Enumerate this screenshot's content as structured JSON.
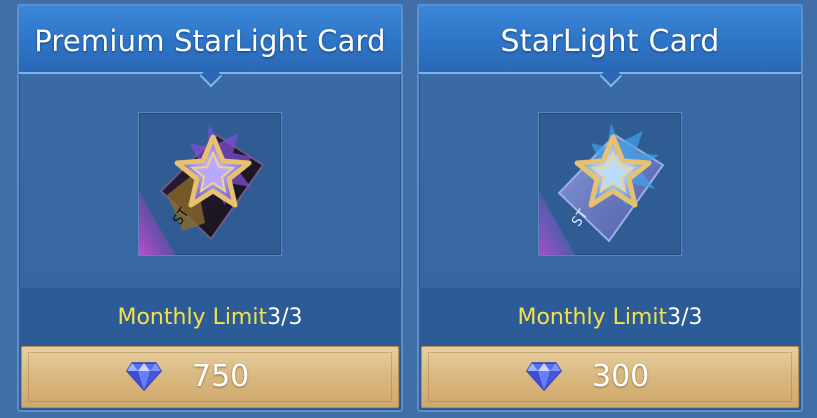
{
  "cards": [
    {
      "title": "Premium StarLight Card",
      "limit_label": "Monthly Limit",
      "limit_count": "3/3",
      "price": "750",
      "icon": "premium-starlight-card-icon",
      "accent": "#8a5cd6"
    },
    {
      "title": "StarLight Card",
      "limit_label": "Monthly Limit",
      "limit_count": "3/3",
      "price": "300",
      "icon": "starlight-card-icon",
      "accent": "#4aa6e8"
    }
  ],
  "currency_icon": "diamond-icon",
  "colors": {
    "limit_label": "#f5e04a",
    "price_button": "#d9b880"
  }
}
